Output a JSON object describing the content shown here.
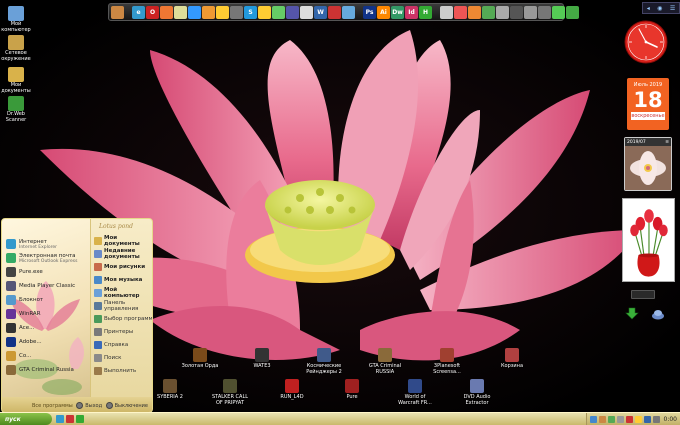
{
  "desktop": {
    "left_icons": [
      {
        "label": "Мой\nкомпьютер",
        "icon": "computer-icon",
        "color": "#6aa0d8"
      },
      {
        "label": "Сетевое\nокружение",
        "icon": "network-icon",
        "color": "#c9a24a"
      },
      {
        "label": "Мои\nдокументы",
        "icon": "folder-icon",
        "color": "#d9b24a"
      },
      {
        "label": "Dr.Web\nScanner",
        "icon": "spider-icon",
        "color": "#3a9a3a"
      }
    ],
    "bottom_icons_row1": [
      {
        "label": "Золотая Орда",
        "icon": "game-icon",
        "color": "#7a4a1a"
      },
      {
        "label": "WATE3",
        "icon": "game-icon",
        "color": "#333333"
      },
      {
        "label": "Космические\nРейнджеры 2",
        "icon": "game-icon",
        "color": "#405a8a"
      },
      {
        "label": "GTA Criminal\nRUSSIA",
        "icon": "game-icon",
        "color": "#8a6a3a"
      },
      {
        "label": "3Planesoft\nScreensa...",
        "icon": "screensaver-icon",
        "color": "#a04030"
      },
      {
        "label": "Корзина",
        "icon": "recycle-bin-icon",
        "color": "#b04040"
      }
    ],
    "bottom_icons_row2": [
      {
        "label": "SYBERIA 2",
        "icon": "game-icon",
        "color": "#6a5030"
      },
      {
        "label": "STALKER CALL\nOF PRIPYAT",
        "icon": "game-icon",
        "color": "#505030"
      },
      {
        "label": "RUN_L4D",
        "icon": "game-icon",
        "color": "#c02020"
      },
      {
        "label": "Pure",
        "icon": "game-icon",
        "color": "#a02020"
      },
      {
        "label": "World of\nWarcraft FR...",
        "icon": "game-icon",
        "color": "#304a8a"
      },
      {
        "label": "DVD Audio\nExtractor",
        "icon": "disc-icon",
        "color": "#6a7ab0"
      }
    ]
  },
  "launchbar": {
    "icons": [
      {
        "name": "image-icon",
        "color": "#c84"
      },
      {
        "name": "ie-icon",
        "color": "#39c",
        "glyph": "e"
      },
      {
        "name": "opera-icon",
        "color": "#c22",
        "glyph": "O"
      },
      {
        "name": "firefox-icon",
        "color": "#e73"
      },
      {
        "name": "bird-icon",
        "color": "#dd9"
      },
      {
        "name": "ball-icon",
        "color": "#39f"
      },
      {
        "name": "media-icon",
        "color": "#e93"
      },
      {
        "name": "player-icon",
        "color": "#fc3"
      },
      {
        "name": "dvd-icon",
        "color": "#777"
      },
      {
        "name": "skype-icon",
        "color": "#29d",
        "glyph": "S"
      },
      {
        "name": "qip-icon",
        "color": "#fc3"
      },
      {
        "name": "chat-icon",
        "color": "#6c6"
      },
      {
        "name": "calc-icon",
        "color": "#55a"
      },
      {
        "name": "window-icon",
        "color": "#ddd"
      },
      {
        "name": "word-icon",
        "color": "#36a",
        "glyph": "W"
      },
      {
        "name": "paint-icon",
        "color": "#c33"
      },
      {
        "name": "pen-icon",
        "color": "#6ad"
      },
      {
        "name": "ps-icon",
        "color": "#138",
        "glyph": "Ps"
      },
      {
        "name": "ai-icon",
        "color": "#f80",
        "glyph": "Ai"
      },
      {
        "name": "dw-icon",
        "color": "#396",
        "glyph": "Dw"
      },
      {
        "name": "id-icon",
        "color": "#c36",
        "glyph": "Id"
      },
      {
        "name": "h-icon",
        "color": "#3a3",
        "glyph": "H"
      },
      {
        "name": "cd-icon",
        "color": "#ccc"
      },
      {
        "name": "flower-icon",
        "color": "#e55"
      },
      {
        "name": "ball-icon",
        "color": "#e83"
      },
      {
        "name": "globe-icon",
        "color": "#5a5"
      },
      {
        "name": "gear-icon",
        "color": "#aaa"
      },
      {
        "name": "camera-icon",
        "color": "#555"
      },
      {
        "name": "usb-icon",
        "color": "#999"
      },
      {
        "name": "tools-icon",
        "color": "#777"
      },
      {
        "name": "arrow-icon",
        "color": "#5c5"
      },
      {
        "name": "leaf-icon",
        "color": "#4a4"
      }
    ]
  },
  "tray_top": {
    "items": [
      "◂",
      "◉",
      "☰"
    ]
  },
  "gadgets": {
    "calendar": {
      "month": "Июль 2019",
      "day": "18",
      "weekday": "воскресенье"
    },
    "photo": {
      "title": "2019/07",
      "caption": "≡"
    }
  },
  "start_menu": {
    "left_items": [
      {
        "label": "Интернет",
        "sub": "Internet Explorer",
        "color": "#39c"
      },
      {
        "label": "Электронная почта",
        "sub": "Microsoft Outlook Express",
        "color": "#3a6"
      },
      {
        "label": "Pure.exe",
        "sub": "",
        "color": "#444"
      },
      {
        "label": "Media Player Classic",
        "sub": "",
        "color": "#557"
      },
      {
        "label": "Блокнот",
        "sub": "",
        "color": "#59c"
      },
      {
        "label": "WinRAR",
        "sub": "",
        "color": "#639"
      },
      {
        "label": "Ace...",
        "sub": "",
        "color": "#333"
      },
      {
        "label": "Adobe...",
        "sub": "",
        "color": "#138"
      },
      {
        "label": "Co...",
        "sub": "",
        "color": "#c93"
      },
      {
        "label": "GTA Criminal Russia",
        "sub": "",
        "color": "#8a6a3a"
      }
    ],
    "right_items": [
      {
        "label": "Мои документы",
        "bold": true
      },
      {
        "label": "Недавние документы",
        "bold": true
      },
      {
        "label": "Мои рисунки",
        "bold": true
      },
      {
        "label": "Моя музыка",
        "bold": true
      },
      {
        "label": "Мой компьютер",
        "bold": true
      },
      {
        "label": "Панель управления",
        "bold": false
      },
      {
        "label": "Выбор программ",
        "bold": false
      },
      {
        "label": "Принтеры",
        "bold": false
      },
      {
        "label": "Справка",
        "bold": false
      },
      {
        "label": "Поиск",
        "bold": false
      },
      {
        "label": "Выполнить",
        "bold": false
      }
    ],
    "brand": "Lotus pond",
    "all_programs": "Все программы",
    "logoff": "Выход",
    "shutdown": "Выключение"
  },
  "taskbar": {
    "start_label": "пуск",
    "quick_colors": [
      "#39c",
      "#c33",
      "#3a3"
    ],
    "tray_colors": [
      "#48c",
      "#c84",
      "#5a5",
      "#999",
      "#c33",
      "#fc3",
      "#36a",
      "#777"
    ],
    "time": "0:00"
  },
  "colors": {
    "accent_start": "#4e8a1e",
    "calendar": "#f26322",
    "clock": "#d8201a"
  }
}
